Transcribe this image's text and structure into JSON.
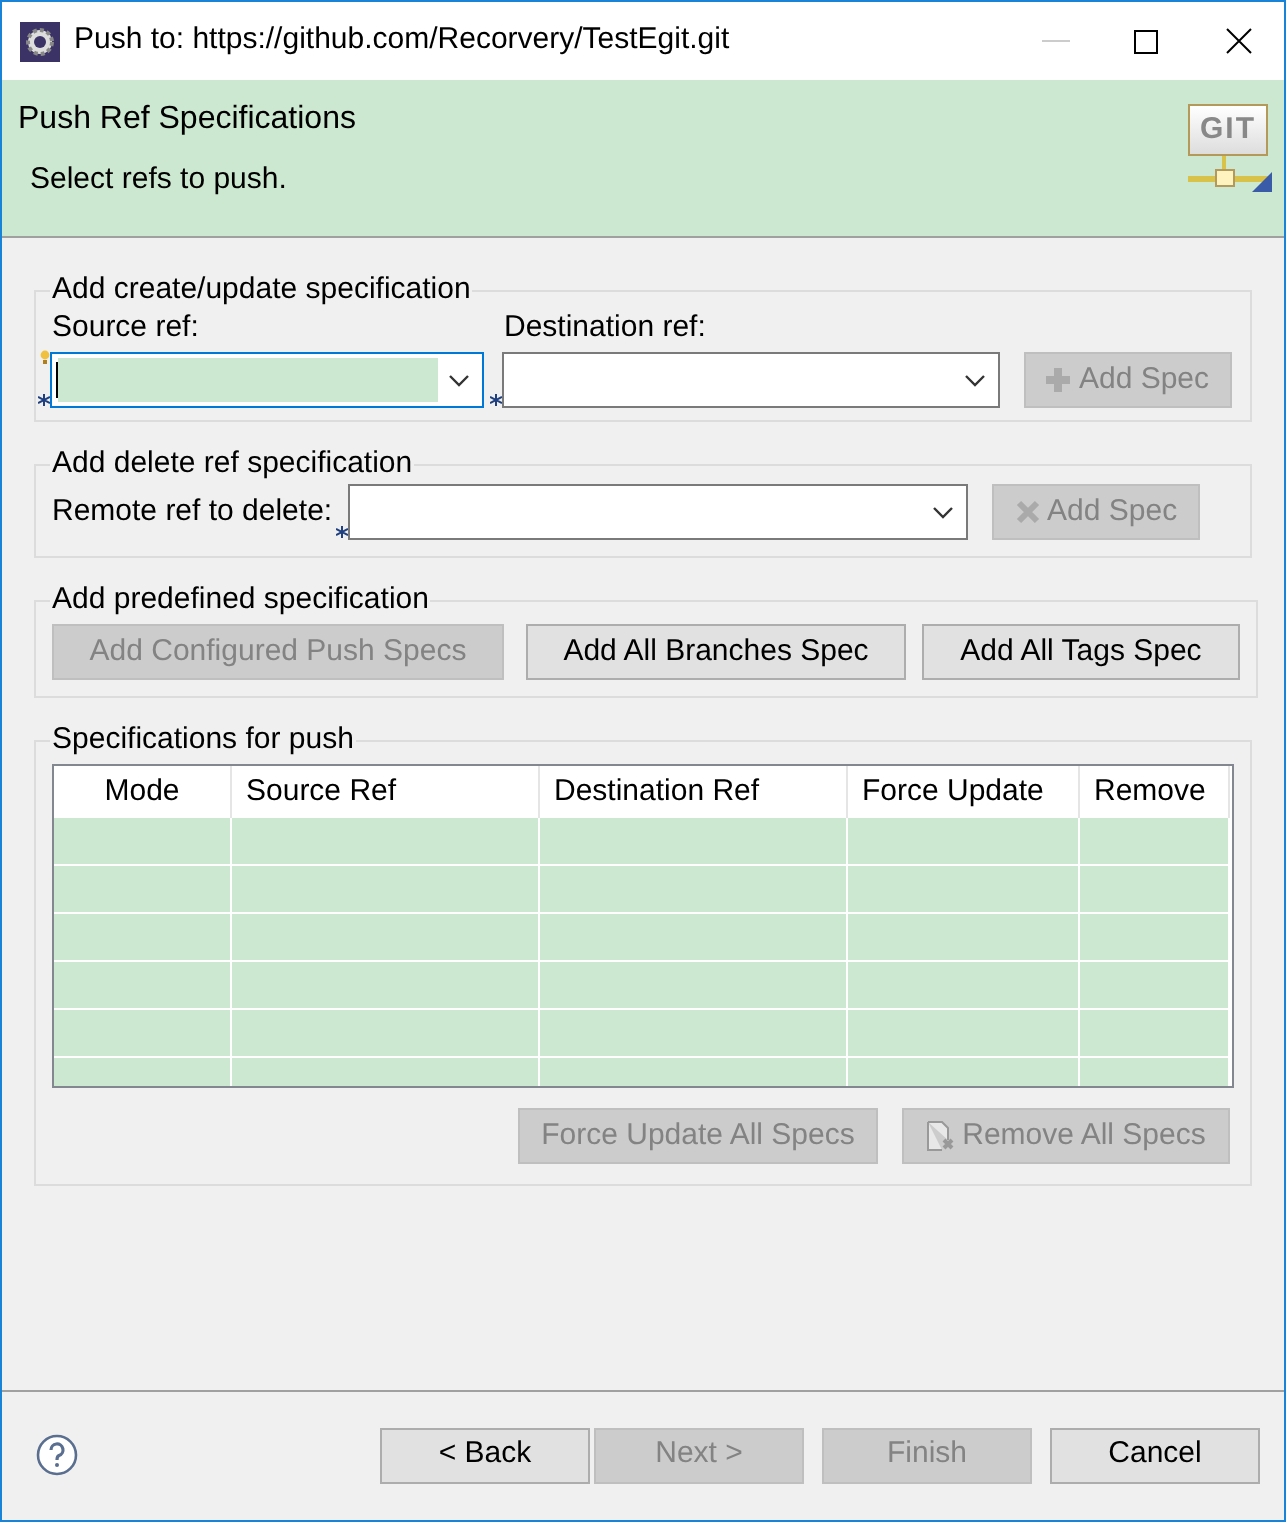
{
  "window": {
    "title": "Push to: https://github.com/Recorvery/TestEgit.git"
  },
  "header": {
    "title": "Push Ref Specifications",
    "description": "Select refs to push.",
    "logo_text": "GIT"
  },
  "create_update": {
    "title": "Add create/update specification",
    "source": {
      "label": "Source ref:",
      "focused": true
    },
    "destination": {
      "label": "Destination ref:",
      "focused": false
    },
    "add_button": {
      "label": "Add Spec",
      "disabled": true
    }
  },
  "delete": {
    "title": "Add delete ref specification",
    "remote": {
      "label": "Remote ref to delete:",
      "focused": false
    },
    "add_button": {
      "label": "Add Spec",
      "disabled": true
    }
  },
  "predefined": {
    "title": "Add predefined specification",
    "buttons": [
      {
        "label": "Add Configured Push Specs",
        "disabled": true
      },
      {
        "label": "Add All Branches Spec",
        "disabled": false
      },
      {
        "label": "Add All Tags Spec",
        "disabled": false
      }
    ]
  },
  "specs": {
    "title": "Specifications for push",
    "columns": [
      "Mode",
      "Source Ref",
      "Destination Ref",
      "Force Update",
      "Remove"
    ],
    "buttons": [
      {
        "kind": "plain",
        "label": "Force Update All Specs",
        "disabled": true
      },
      {
        "kind": "remove",
        "label": "Remove All Specs",
        "disabled": true
      }
    ]
  },
  "footer": {
    "buttons": [
      {
        "label": "< Back",
        "disabled": false
      },
      {
        "label": "Next >",
        "disabled": true
      },
      {
        "label": "Finish",
        "disabled": true
      },
      {
        "label": "Cancel",
        "disabled": false
      }
    ]
  }
}
